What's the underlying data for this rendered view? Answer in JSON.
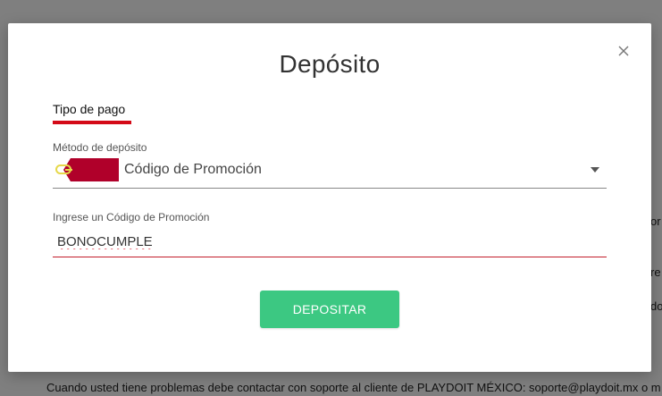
{
  "modal": {
    "title": "Depósito",
    "tab_label": "Tipo de pago",
    "method_label": "Método de depósito",
    "method_value": "Código de Promoción",
    "code_label": "Ingrese un Código de Promoción",
    "code_value": "BONOCUMPLE",
    "deposit_button": "DEPOSITAR"
  },
  "background": {
    "footer_text": "Cuando usted tiene problemas debe contactar con soporte al cliente de PLAYDOIT MÉXICO: soporte@playdoit.mx o m",
    "frag_1": "or",
    "frag_2": "re",
    "frag_3": "do"
  },
  "colors": {
    "accent_red": "#d40b18",
    "button_green": "#3cc882",
    "tag_red": "#b0002a",
    "tag_yellow": "#e6d84a"
  },
  "icons": {
    "close": "close-icon",
    "promo": "promo-tag-icon",
    "dropdown": "chevron-down-icon"
  }
}
